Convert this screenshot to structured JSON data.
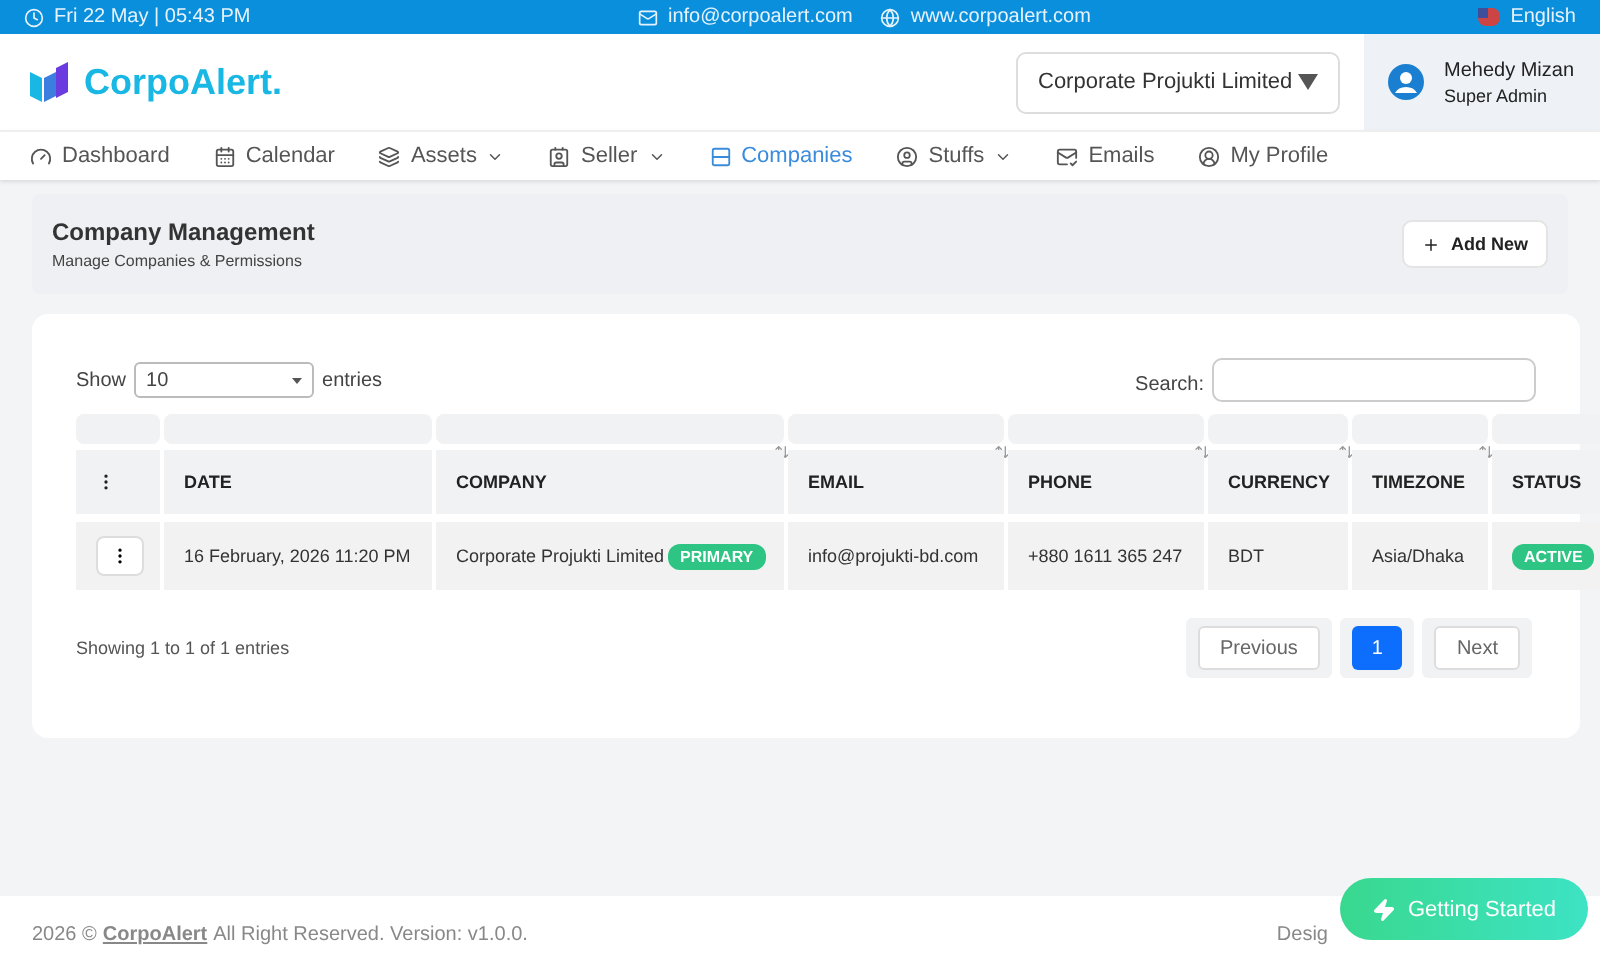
{
  "topbar": {
    "datetime": "Fri 22 May | 05:43 PM",
    "email": "info@corpoalert.com",
    "website": "www.corpoalert.com",
    "language": "English"
  },
  "header": {
    "logo": "CorpoAlert.",
    "company_select": "Corporate Projukti Limited",
    "user": {
      "name": "Mehedy Mizan",
      "role": "Super Admin"
    }
  },
  "nav": [
    {
      "label": "Dashboard",
      "dropdown": false,
      "selected": false
    },
    {
      "label": "Calendar",
      "dropdown": false,
      "selected": false
    },
    {
      "label": "Assets",
      "dropdown": true,
      "selected": false
    },
    {
      "label": "Seller",
      "dropdown": true,
      "selected": false
    },
    {
      "label": "Companies",
      "dropdown": false,
      "selected": true
    },
    {
      "label": "Stuffs",
      "dropdown": true,
      "selected": false
    },
    {
      "label": "Emails",
      "dropdown": false,
      "selected": false
    },
    {
      "label": "My Profile",
      "dropdown": false,
      "selected": false
    }
  ],
  "page_header": {
    "title": "Company Management",
    "subtitle": "Manage Companies & Permissions",
    "add_button": "Add New"
  },
  "table_controls": {
    "show_label": "Show",
    "page_size": "10",
    "entries_label": "entries",
    "search_label": "Search:"
  },
  "table": {
    "columns": [
      "DATE",
      "COMPANY",
      "EMAIL",
      "PHONE",
      "CURRENCY",
      "TIMEZONE",
      "STATUS"
    ],
    "rows": [
      {
        "date": "16 February, 2026 11:20 PM",
        "company": "Corporate Projukti Limited",
        "company_badge": "PRIMARY",
        "email": "info@projukti-bd.com",
        "phone": "+880 1611 365 247",
        "currency": "BDT",
        "timezone": "Asia/Dhaka",
        "status": "ACTIVE"
      }
    ]
  },
  "pagination": {
    "info": "Showing 1 to 1 of 1 entries",
    "previous": "Previous",
    "pages": [
      {
        "label": "1",
        "selected": true
      }
    ],
    "next": "Next"
  },
  "footer": {
    "year": "2026 ©",
    "brand": "CorpoAlert",
    "rest": "All Right Reserved. Version: v1.0.0.",
    "right_visible": "Desig",
    "getting_started": "Getting Started"
  }
}
